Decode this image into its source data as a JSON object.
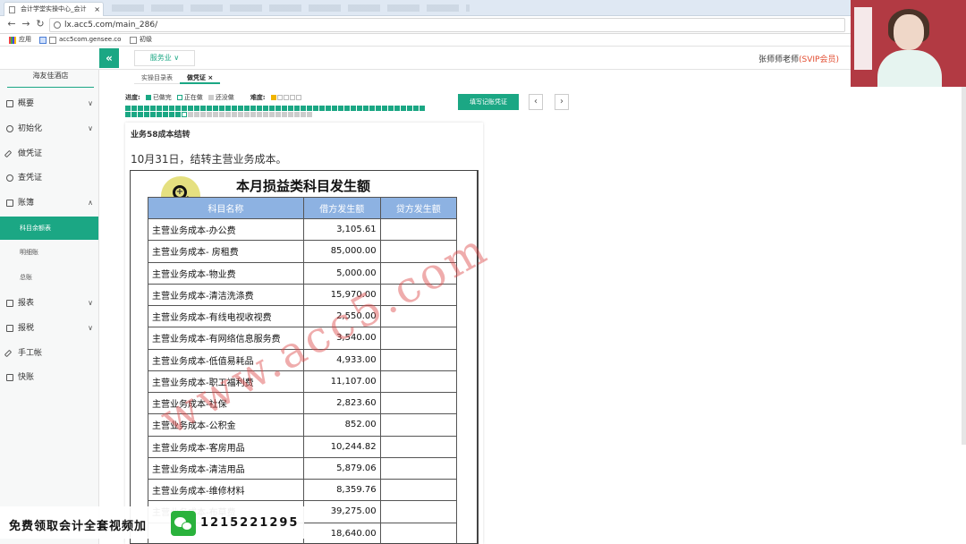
{
  "browser": {
    "tab_title": "会计学堂实操中心_会计",
    "tab_close": "×",
    "url": "lx.acc5.com/main_286/",
    "bookmarks": [
      "应用",
      "acc5com.gensee.co",
      "初级"
    ]
  },
  "header": {
    "collapse_icon": "«",
    "industry": "服务业 ∨",
    "teacher": "张师师老师",
    "vip": "(SVIP会员)"
  },
  "sidebar": {
    "org": "海友佳酒店",
    "items": [
      {
        "label": "概要",
        "icon": "overview-icon",
        "chev": "∨"
      },
      {
        "label": "初始化",
        "icon": "settings-icon",
        "chev": "∨"
      },
      {
        "label": "做凭证",
        "icon": "pen-icon",
        "chev": ""
      },
      {
        "label": "查凭证",
        "icon": "search-icon",
        "chev": ""
      },
      {
        "label": "账簿",
        "icon": "book-icon",
        "chev": "∧"
      },
      {
        "label": "报表",
        "icon": "report-icon",
        "chev": "∨"
      },
      {
        "label": "报税",
        "icon": "tax-icon",
        "chev": "∨"
      },
      {
        "label": "手工帐",
        "icon": "pen-icon",
        "chev": ""
      },
      {
        "label": "快账",
        "icon": "file-icon",
        "chev": ""
      }
    ],
    "sub_items": [
      "科目余额表",
      "明细账",
      "总账"
    ]
  },
  "content_tabs": [
    "实操目录表",
    "做凭证 ×"
  ],
  "progress": {
    "label": "进度:",
    "done": "已做完",
    "doing": "正在做",
    "todo": "还没做",
    "difficulty_label": "难度:",
    "difficulty_level": 1,
    "difficulty_max": 5,
    "total_cells": 78,
    "done_cells": 57,
    "current_cell": 58
  },
  "actions": {
    "fill_voucher": "填写记账凭证",
    "prev": "‹",
    "next": "›"
  },
  "task": {
    "title": "业务58成本结转",
    "description": "10月31日，结转主营业务成本。"
  },
  "document": {
    "title": "本月损益类科目发生额",
    "columns": [
      "科目名称",
      "借方发生额",
      "贷方发生额"
    ],
    "rows": [
      [
        "主营业务成本-办公费",
        "3,105.61",
        ""
      ],
      [
        "主营业务成本- 房租费",
        "85,000.00",
        ""
      ],
      [
        "主营业务成本-物业费",
        "5,000.00",
        ""
      ],
      [
        "主营业务成本-清洁洗涤费",
        "15,970.00",
        ""
      ],
      [
        "主营业务成本-有线电视收视费",
        "2,550.00",
        ""
      ],
      [
        "主营业务成本-有网络信息服务费",
        "3,540.00",
        ""
      ],
      [
        "主营业务成本-低值易耗品",
        "4,933.00",
        ""
      ],
      [
        "主营业务成本-职工福利费",
        "11,107.00",
        ""
      ],
      [
        "主营业务成本-社保",
        "2,823.60",
        ""
      ],
      [
        "主营业务成本-公积金",
        "852.00",
        ""
      ],
      [
        "主营业务成本-客房用品",
        "10,244.82",
        ""
      ],
      [
        "主营业务成本-清洁用品",
        "5,879.06",
        ""
      ],
      [
        "主营业务成本-维修材料",
        "8,359.76",
        ""
      ],
      [
        "主营业务成本-布草费",
        "39,275.00",
        ""
      ],
      [
        "",
        "18,640.00",
        ""
      ]
    ],
    "watermark": "www.acc5.com"
  },
  "promo": {
    "text": "免费领取会计全套视频加",
    "number": "1215221295"
  },
  "colors": {
    "accent": "#1ba784",
    "table_header": "#8db2e2",
    "vip": "#e24b2f"
  }
}
